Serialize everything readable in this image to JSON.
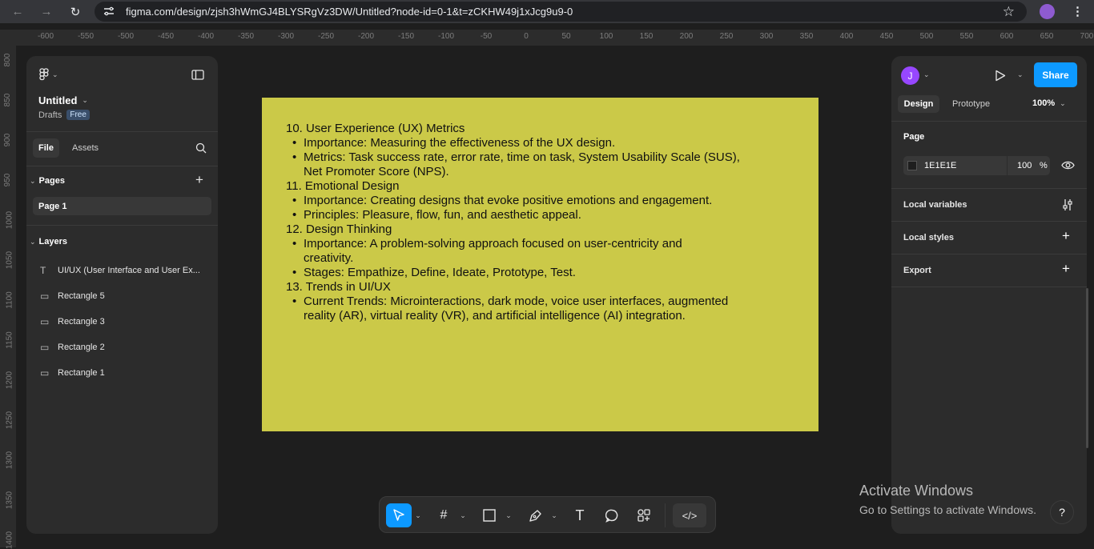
{
  "browser": {
    "url": "figma.com/design/zjsh3hWmGJ4BLYSRgVz3DW/Untitled?node-id=0-1&t=zCKHW49j1xJcg9u9-0"
  },
  "ruler": {
    "top": [
      "-600",
      "-550",
      "-500",
      "-450",
      "-400",
      "-350",
      "-300",
      "-250",
      "-200",
      "-150",
      "-100",
      "-50",
      "0",
      "50",
      "100",
      "150",
      "200",
      "250",
      "300",
      "350",
      "400",
      "450",
      "500",
      "550",
      "600",
      "650",
      "700"
    ],
    "left": [
      "800",
      "850",
      "900",
      "950",
      "1000",
      "1050",
      "1100",
      "1150",
      "1200",
      "1250",
      "1300",
      "1350",
      "1400"
    ]
  },
  "left_panel": {
    "file_title": "Untitled",
    "drafts": "Drafts",
    "plan_badge": "Free",
    "tabs": {
      "file": "File",
      "assets": "Assets"
    },
    "pages_header": "Pages",
    "pages": [
      "Page 1"
    ],
    "layers_header": "Layers",
    "layers": [
      {
        "icon": "text-icon",
        "name": "UI/UX (User Interface and User Ex..."
      },
      {
        "icon": "rectangle-icon",
        "name": "Rectangle 5"
      },
      {
        "icon": "rectangle-icon",
        "name": "Rectangle 3"
      },
      {
        "icon": "rectangle-icon",
        "name": "Rectangle 2"
      },
      {
        "icon": "rectangle-icon",
        "name": "Rectangle 1"
      }
    ]
  },
  "right_panel": {
    "avatar_letter": "J",
    "share": "Share",
    "tabs": {
      "design": "Design",
      "prototype": "Prototype"
    },
    "zoom": "100%",
    "page_section": "Page",
    "page_color": "1E1E1E",
    "page_opacity": "100",
    "percent": "%",
    "local_variables": "Local variables",
    "local_styles": "Local styles",
    "export": "Export"
  },
  "frame": {
    "color": "#cbc948",
    "lines": [
      {
        "kind": "heading",
        "text": "10. User Experience (UX) Metrics"
      },
      {
        "kind": "bullet",
        "text": "Importance: Measuring the effectiveness of the UX design."
      },
      {
        "kind": "bullet",
        "text": "Metrics: Task success rate, error rate, time on task, System Usability Scale (SUS),"
      },
      {
        "kind": "cont",
        "text": "Net Promoter Score (NPS)."
      },
      {
        "kind": "heading",
        "text": "11. Emotional Design"
      },
      {
        "kind": "bullet",
        "text": "Importance: Creating designs that evoke positive emotions and engagement."
      },
      {
        "kind": "bullet",
        "text": "Principles: Pleasure, flow, fun, and aesthetic appeal."
      },
      {
        "kind": "heading",
        "text": "12. Design Thinking"
      },
      {
        "kind": "bullet",
        "text": "Importance: A problem-solving approach focused on user-centricity and"
      },
      {
        "kind": "cont",
        "text": "creativity."
      },
      {
        "kind": "bullet",
        "text": "Stages: Empathize, Define, Ideate, Prototype, Test."
      },
      {
        "kind": "heading",
        "text": "13. Trends in UI/UX"
      },
      {
        "kind": "bullet",
        "text": "Current Trends: Microinteractions, dark mode, voice user interfaces, augmented"
      },
      {
        "kind": "cont",
        "text": "reality (AR), virtual reality (VR), and artificial intelligence (AI) integration."
      }
    ]
  },
  "watermark": {
    "title": "Activate Windows",
    "subtitle": "Go to Settings to activate Windows."
  },
  "help": "?",
  "colors": {
    "accent": "#0d99ff",
    "avatar": "#9747ff",
    "frame": "#cbc948"
  }
}
